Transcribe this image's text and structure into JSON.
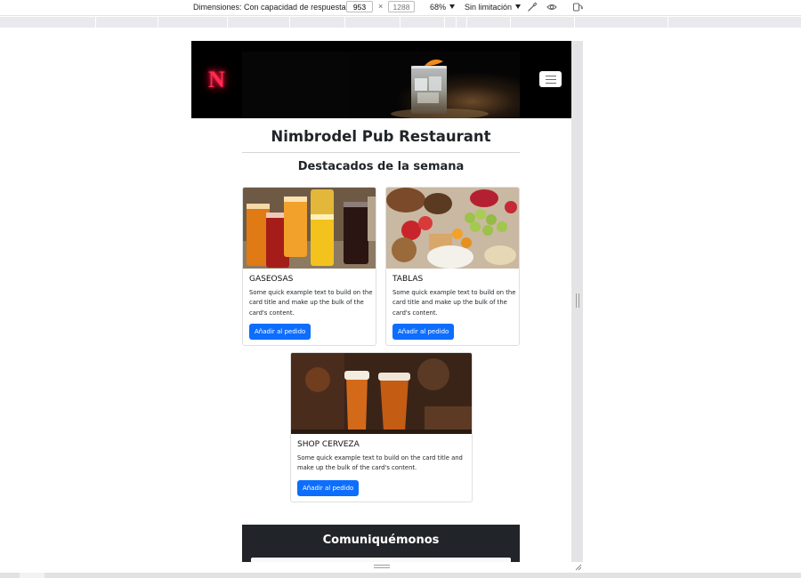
{
  "devtools": {
    "dimensions_label": "Dimensiones: Con capacidad de respuesta",
    "width_value": "953",
    "height_placeholder": "1288",
    "zoom": "68%",
    "throttle": "Sin limitación"
  },
  "site": {
    "brand": "N",
    "title": "Nimbrodel Pub Restaurant",
    "featured_heading": "Destacados de la semana",
    "cards": [
      {
        "title": "GASEOSAS",
        "text_lines": [
          "Some quick example text to build on the",
          "card title and make up the bulk of the",
          "card's content."
        ],
        "button": "Añadir al pedido"
      },
      {
        "title": "TABLAS",
        "text_lines": [
          "Some quick example text to build on the",
          "card title and make up the bulk of the",
          "card's content."
        ],
        "button": "Añadir al pedido"
      },
      {
        "title": "SHOP CERVEZA",
        "text_lines": [
          "Some quick example text to build on the card title and",
          "make up the bulk of the card's content."
        ],
        "button": "Añadir al pedido"
      }
    ],
    "contact_heading": "Comuniquémonos"
  },
  "colors": {
    "primary_button": "#0d6efd",
    "navbar_bg": "#000000",
    "contact_bg": "#212529",
    "brand_neon": "#ff2d4e"
  },
  "icons": [
    "chevron-down-icon",
    "eyedropper-icon",
    "eye-icon",
    "device-rotate-icon",
    "hamburger-icon"
  ]
}
